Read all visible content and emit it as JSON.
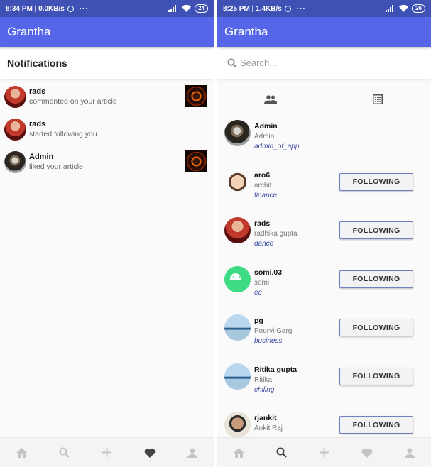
{
  "left_screen": {
    "status": {
      "time": "8:34 PM | 0.0KB/s",
      "dots": "···",
      "battery": "24"
    },
    "app_title": "Grantha",
    "section_title": "Notifications",
    "notifications": [
      {
        "user": "rads",
        "message": "commented on your article",
        "avatar": "user-photo-red",
        "has_thumbnail": true
      },
      {
        "user": "rads",
        "message": "started following you",
        "avatar": "user-photo-red",
        "has_thumbnail": false
      },
      {
        "user": "Admin",
        "message": "liked your article",
        "avatar": "coffee-cup-photo",
        "has_thumbnail": true
      }
    ],
    "bottom_nav": [
      {
        "icon": "home-icon",
        "active": false
      },
      {
        "icon": "search-icon",
        "active": false
      },
      {
        "icon": "add-icon",
        "active": false
      },
      {
        "icon": "heart-icon",
        "active": true
      },
      {
        "icon": "person-icon",
        "active": false
      }
    ]
  },
  "right_screen": {
    "status": {
      "time": "8:25 PM | 1.4KB/s",
      "dots": "···",
      "battery": "26"
    },
    "app_title": "Grantha",
    "search": {
      "placeholder": "Search...",
      "value": ""
    },
    "tabs": [
      {
        "icon": "people-icon",
        "active": true
      },
      {
        "icon": "article-list-icon",
        "active": false
      }
    ],
    "users": [
      {
        "username": "Admin",
        "full_name": "Admin",
        "category": "admin_of_app",
        "button": null
      },
      {
        "username": "aro6",
        "full_name": "archit",
        "category": "finance",
        "button": "FOLLOWING"
      },
      {
        "username": "rads",
        "full_name": "radhika gupta",
        "category": "dance",
        "button": "FOLLOWING"
      },
      {
        "username": "somi.03",
        "full_name": "somi",
        "category": "ee",
        "button": "FOLLOWING"
      },
      {
        "username": "pg_",
        "full_name": "Poorvi Garg",
        "category": "business",
        "button": "FOLLOWING"
      },
      {
        "username": "Ritika gupta",
        "full_name": "Ritika",
        "category": "chiling",
        "button": "FOLLOWING"
      },
      {
        "username": "rjankit",
        "full_name": "Ankit Raj",
        "category": "",
        "button": "FOLLOWING"
      }
    ],
    "bottom_nav": [
      {
        "icon": "home-icon",
        "active": false
      },
      {
        "icon": "search-icon",
        "active": true
      },
      {
        "icon": "add-icon",
        "active": false
      },
      {
        "icon": "heart-icon",
        "active": false
      },
      {
        "icon": "person-icon",
        "active": false
      }
    ]
  },
  "colors": {
    "status_bar": "#3f51b5",
    "app_bar": "#5566e8",
    "accent_text": "#3b4ba5",
    "nav_active": "#444444",
    "nav_inactive": "#c4c4c4"
  }
}
